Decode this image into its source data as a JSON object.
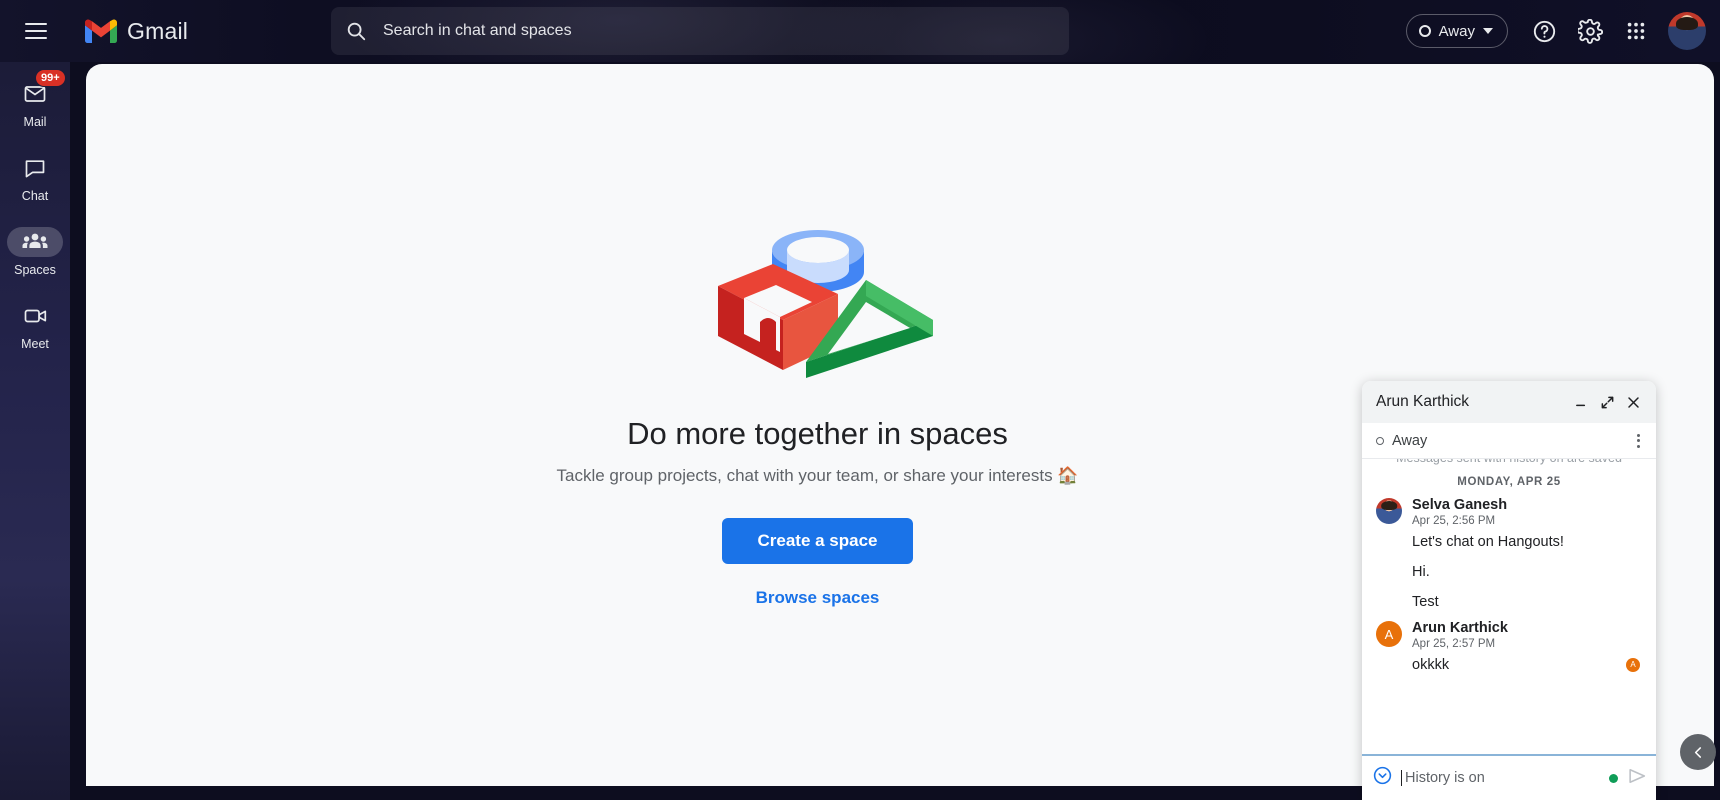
{
  "header": {
    "menu_icon": "hamburger-icon",
    "brand": "Gmail",
    "search": {
      "icon": "search-icon",
      "placeholder": "Search in chat and spaces",
      "value": ""
    },
    "status_label": "Away",
    "status_icon": "status-circle-icon",
    "help_icon": "help-icon",
    "settings_icon": "gear-icon",
    "apps_icon": "apps-grid-icon",
    "avatar": "user-avatar"
  },
  "rail": {
    "items": [
      {
        "label": "Mail",
        "icon": "mail-icon",
        "badge": "99+",
        "active": false
      },
      {
        "label": "Chat",
        "icon": "chat-bubble-icon",
        "badge": "",
        "active": false
      },
      {
        "label": "Spaces",
        "icon": "people-icon",
        "badge": "",
        "active": true
      },
      {
        "label": "Meet",
        "icon": "video-camera-icon",
        "badge": "",
        "active": false
      }
    ]
  },
  "main": {
    "illustration": "spaces-3d-shapes-illustration",
    "title": "Do more together in spaces",
    "subtitle": "Tackle group projects, chat with your team, or share your interests 🏠",
    "create_button": "Create a space",
    "browse_link": "Browse spaces"
  },
  "chat_window": {
    "title": "Arun Karthick",
    "minimize_icon": "minimize-icon",
    "expand_icon": "expand-icon",
    "close_icon": "close-icon",
    "status": "Away",
    "status_icon": "status-circle-icon",
    "menu_icon": "kebab-menu-icon",
    "system_note": "Messages sent with history on are saved",
    "date_separator": "MONDAY, APR 25",
    "groups": [
      {
        "sender": "Selva Ganesh",
        "time": "Apr 25, 2:56 PM",
        "avatar_type": "photo",
        "avatar_letter": "",
        "messages": [
          {
            "text": "Let's chat on Hangouts!",
            "receipt": ""
          },
          {
            "text": "Hi.",
            "receipt": ""
          },
          {
            "text": "Test",
            "receipt": ""
          }
        ]
      },
      {
        "sender": "Arun Karthick",
        "time": "Apr 25, 2:57 PM",
        "avatar_type": "letter",
        "avatar_letter": "A",
        "messages": [
          {
            "text": "okkkk",
            "receipt": "A"
          }
        ]
      }
    ],
    "compose": {
      "history_icon": "history-on-icon",
      "placeholder": "History is on",
      "value": "",
      "presence_dot": "online-dot",
      "send_icon": "send-icon"
    }
  },
  "collapse_button": {
    "icon": "chevron-left-icon"
  },
  "colors": {
    "accent_blue": "#1a73e8",
    "badge_red": "#d93025",
    "header_dark": "#0b0b1c",
    "surface": "#f8f9fa",
    "orange_avatar": "#e8710a",
    "green_dot": "#0f9d58"
  }
}
